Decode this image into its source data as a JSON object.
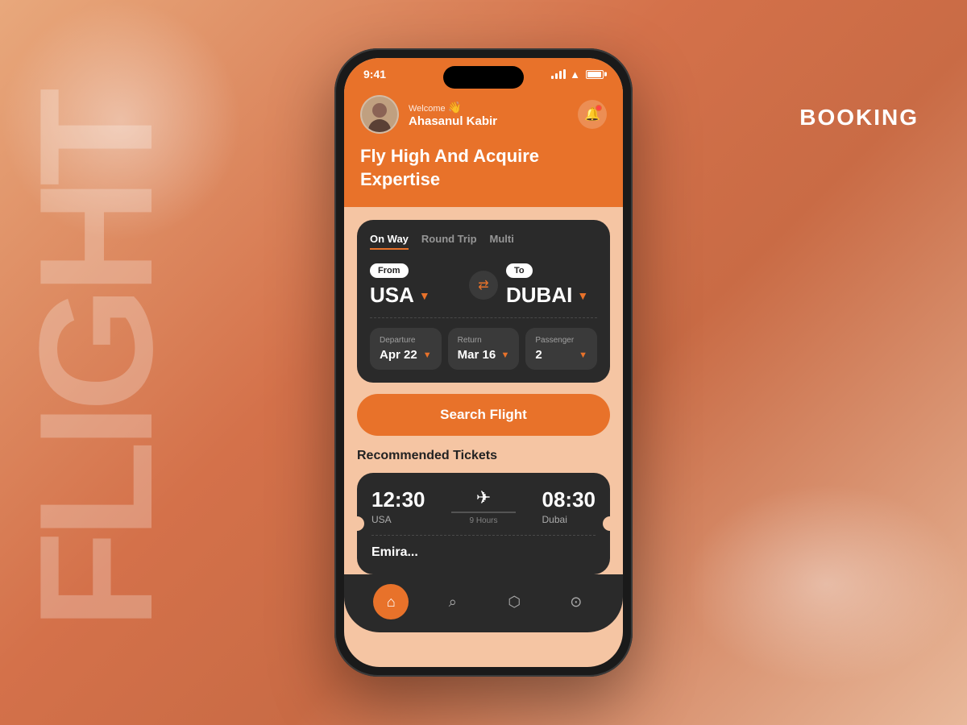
{
  "background": {
    "title": "BOOKING"
  },
  "watermark": "FLIGHT",
  "phone": {
    "status_bar": {
      "time": "9:41"
    },
    "header": {
      "welcome_label": "Welcome",
      "wave_emoji": "👋",
      "user_name": "Ahasanul Kabir",
      "headline_line1": "Fly High And Acquire",
      "headline_line2": "Expertise"
    },
    "search_card": {
      "tabs": [
        {
          "label": "On Way",
          "active": true
        },
        {
          "label": "Round Trip",
          "active": false
        },
        {
          "label": "Multi",
          "active": false
        }
      ],
      "from_label": "From",
      "to_label": "To",
      "from_city": "USA",
      "to_city": "DUBAI",
      "swap_symbol": "⇄",
      "departure_label": "Departure",
      "departure_value": "Apr 22",
      "return_label": "Return",
      "return_value": "Mar 16",
      "passenger_label": "Passenger",
      "passenger_value": "2",
      "search_button": "Search Flight"
    },
    "recommended": {
      "section_title": "Recommended Tickets",
      "ticket": {
        "depart_time": "12:30",
        "depart_city": "USA",
        "arrive_time": "08:30",
        "arrive_city": "Dubai",
        "duration": "9 Hours",
        "airline": "Emira..."
      }
    },
    "bottom_nav": {
      "items": [
        {
          "name": "home",
          "icon": "⌂",
          "active": true
        },
        {
          "name": "search",
          "icon": "🔍",
          "active": false
        },
        {
          "name": "tickets",
          "icon": "🎫",
          "active": false
        },
        {
          "name": "profile",
          "icon": "👤",
          "active": false
        }
      ]
    }
  }
}
